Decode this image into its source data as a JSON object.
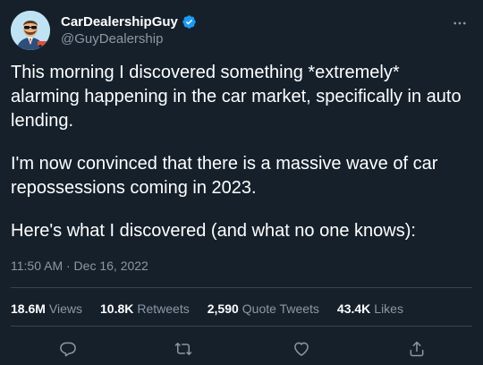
{
  "author": {
    "display_name": "CarDealershipGuy",
    "handle": "@GuyDealership",
    "verified": true
  },
  "tweet": {
    "paragraphs": [
      "This morning I discovered something *extremely* alarming happening in the car market, specifically in auto lending.",
      "I'm now convinced that there is a massive wave of car repossessions coming in 2023.",
      "Here's what I discovered (and what no one knows):"
    ],
    "timestamp": "11:50 AM · Dec 16, 2022"
  },
  "stats": {
    "views_count": "18.6M",
    "views_label": "Views",
    "retweets_count": "10.8K",
    "retweets_label": "Retweets",
    "quotes_count": "2,590",
    "quotes_label": "Quote Tweets",
    "likes_count": "43.4K",
    "likes_label": "Likes"
  },
  "actions": {
    "icons": [
      "reply-icon",
      "retweet-icon",
      "like-icon",
      "share-icon"
    ]
  },
  "colors": {
    "background": "#15202b",
    "text_primary": "#ffffff",
    "text_secondary": "#8b98a5",
    "divider": "#38444d",
    "verified_blue": "#1d9bf0"
  }
}
